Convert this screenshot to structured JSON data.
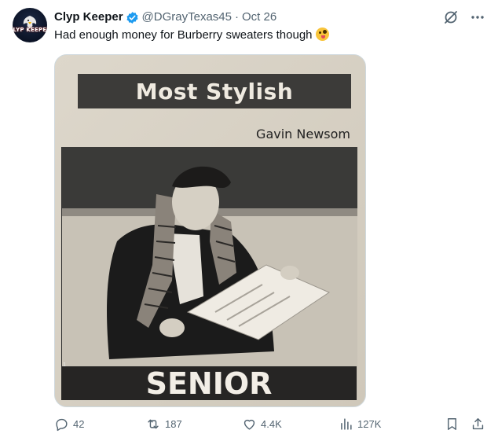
{
  "author": {
    "name": "Clyp Keeper",
    "handle": "@DGrayTexas45",
    "separator": "·",
    "date": "Oct 26",
    "avatar_text": "CLYP KEEPER"
  },
  "tweet": {
    "text": "Had enough money for Burberry sweaters though",
    "emoji": "zany-face-emoji"
  },
  "media": {
    "banner_top": "Most Stylish",
    "caption_name": "Gavin Newsom",
    "banner_bottom": "SENIOR",
    "page_marker": "1"
  },
  "actions": {
    "replies": "42",
    "reposts": "187",
    "likes": "4.4K",
    "views": "127K"
  },
  "colors": {
    "text": "#0f1419",
    "muted": "#536471",
    "verified": "#1d9bf0"
  }
}
